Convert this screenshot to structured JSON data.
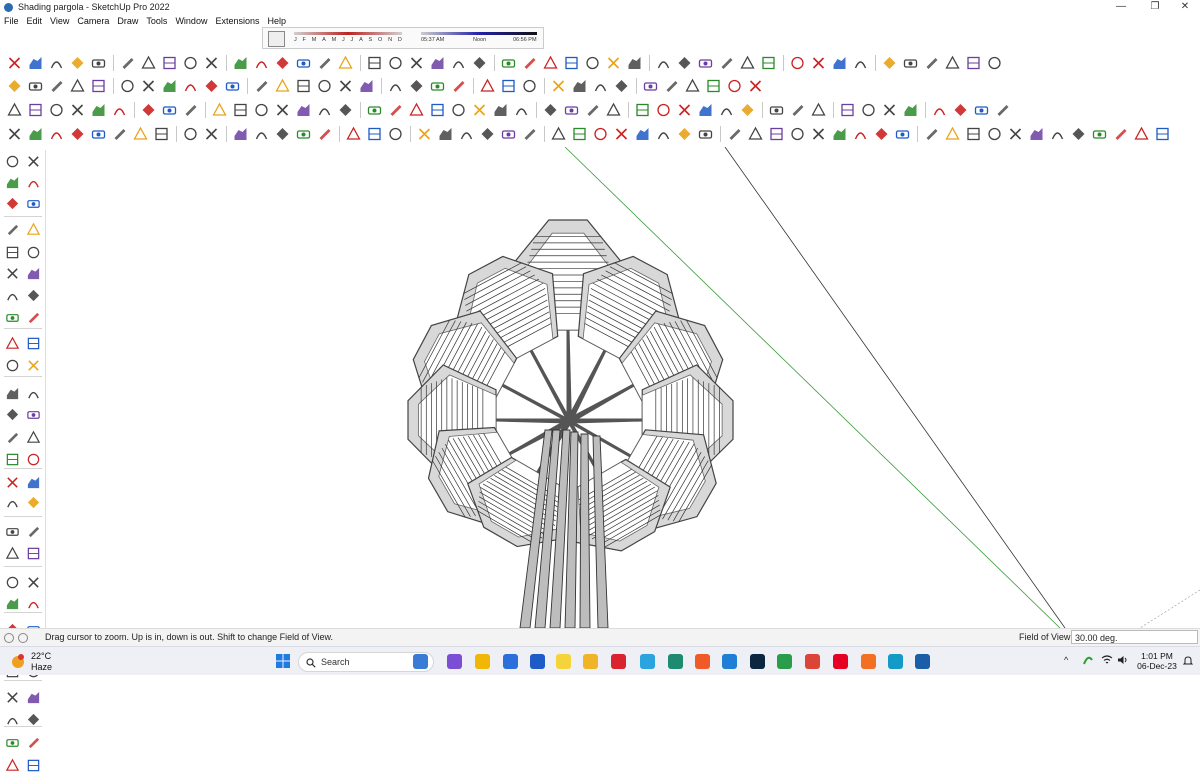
{
  "window": {
    "title": "Shading pargola - SketchUp Pro 2022",
    "controls": [
      "—",
      "❐",
      "✕"
    ]
  },
  "menu": [
    "File",
    "Edit",
    "View",
    "Camera",
    "Draw",
    "Tools",
    "Window",
    "Extensions",
    "Help"
  ],
  "shadows": {
    "months": [
      "J",
      "F",
      "M",
      "A",
      "M",
      "J",
      "J",
      "A",
      "S",
      "O",
      "N",
      "D"
    ],
    "time_start": "05:37 AM",
    "time_mid": "Noon",
    "time_end": "06:56 PM"
  },
  "statusbar": {
    "hint": "Drag cursor to zoom.  Up is in, down is out. Shift to change Field of View.",
    "measure_label": "Field of View",
    "measure_value": "30.00 deg."
  },
  "taskbar": {
    "weather_temp": "22°C",
    "weather_cond": "Haze",
    "search_label": "Search",
    "time": "1:01 PM",
    "date": "06-Dec-23",
    "tray_chevron": "^"
  },
  "colors": {
    "accent_red": "#cc2222",
    "accent_blue": "#1e5bc6",
    "accent_orange": "#e8a317",
    "taskbar_bg": "#eef0f6",
    "axis_green": "#3a9b3a"
  },
  "icons": {
    "toolbar": [
      "paint-bucket-icon",
      "eraser-icon",
      "pencil-icon",
      "arc-icon",
      "push-pull-icon",
      "move-icon",
      "rotate-icon",
      "scale-icon",
      "tape-measure-icon",
      "orbit-icon",
      "pan-icon",
      "zoom-icon",
      "zoom-extents-icon"
    ]
  }
}
